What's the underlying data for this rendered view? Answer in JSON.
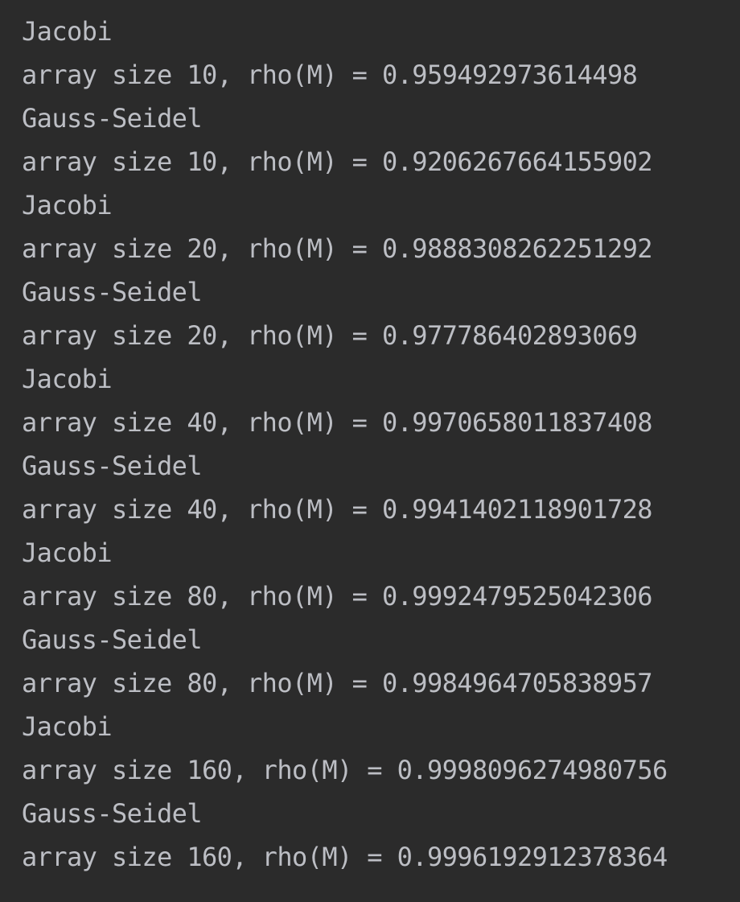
{
  "console": {
    "lines": [
      "Jacobi",
      "array size 10, rho(M) = 0.959492973614498",
      "Gauss-Seidel",
      "array size 10, rho(M) = 0.9206267664155902",
      "Jacobi",
      "array size 20, rho(M) = 0.9888308262251292",
      "Gauss-Seidel",
      "array size 20, rho(M) = 0.977786402893069",
      "Jacobi",
      "array size 40, rho(M) = 0.9970658011837408",
      "Gauss-Seidel",
      "array size 40, rho(M) = 0.9941402118901728",
      "Jacobi",
      "array size 80, rho(M) = 0.9992479525042306",
      "Gauss-Seidel",
      "array size 80, rho(M) = 0.9984964705838957",
      "Jacobi",
      "array size 160, rho(M) = 0.9998096274980756",
      "Gauss-Seidel",
      "array size 160, rho(M) = 0.9996192912378364"
    ]
  },
  "colors": {
    "background": "#2b2b2b",
    "text": "#bcbec4"
  }
}
